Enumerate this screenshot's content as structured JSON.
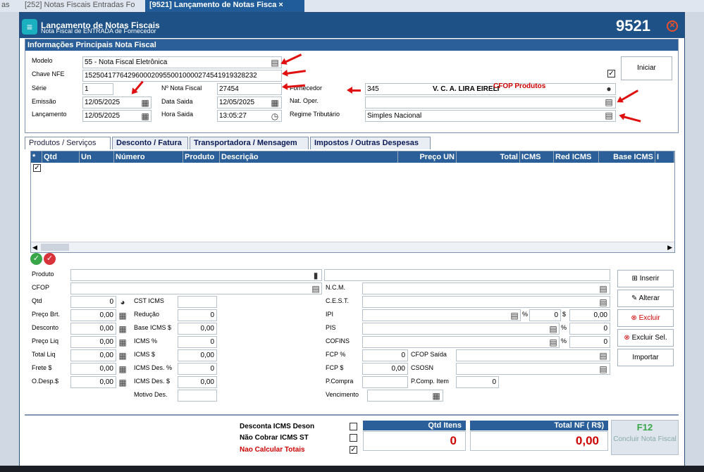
{
  "tabs": {
    "t1": "as",
    "t2": "[252] Notas Fiscais Entradas Fo",
    "t3": "[9521] Lançamento de Notas Fisca",
    "close": "×"
  },
  "window": {
    "title": "Lançamento de Notas Fiscais",
    "subtitle": "Nota Fiscal de ENTRADA de Fornecedor",
    "code": "9521"
  },
  "info": {
    "header": "Informações Principais Nota Fiscal",
    "modelo_lbl": "Modelo",
    "modelo": "55 - Nota Fiscal Eletrônica",
    "chave_lbl": "Chave NFE",
    "chave": "15250417764296000209550010000274541919328232",
    "serie_lbl": "Série",
    "serie": "1",
    "nnota_lbl": "Nº Nota Fiscal",
    "nnota": "27454",
    "emissao_lbl": "Emissão",
    "emissao": "12/05/2025",
    "datasaida_lbl": "Data Saida",
    "datasaida": "12/05/2025",
    "lanc_lbl": "Lançamento",
    "lanc": "12/05/2025",
    "horasaida_lbl": "Hora Saida",
    "horasaida": "13:05:27",
    "fornecedor_lbl": "Fornecedor",
    "fornecedor_cod": "345",
    "fornecedor_nome": "V. C. A. LIRA EIRELI",
    "natoper_lbl": "Nat. Oper.",
    "natoper": "",
    "regime_lbl": "Regime Tributário",
    "regime": "Simples Nacional",
    "cfop_lbl": "CFOP Produtos",
    "iniciar": "Iniciar"
  },
  "subtabs": [
    "Produtos / Serviços",
    "Desconto / Fatura",
    "Transportadora / Mensagem",
    "Impostos / Outras Despesas"
  ],
  "grid": {
    "cols": [
      "*",
      "Qtd",
      "Un",
      "Número",
      "Produto",
      "Descrição",
      "Preço UN",
      "Total",
      "ICMS",
      "Red ICMS",
      "Base ICMS",
      "I"
    ]
  },
  "item": {
    "produto_lbl": "Produto",
    "produto": "",
    "cfop_lbl": "CFOP",
    "cfop": "",
    "qtd_lbl": "Qtd",
    "qtd": "0",
    "precobrt_lbl": "Preço Brt.",
    "precobrt": "0,00",
    "desconto_lbl": "Desconto",
    "desconto": "0,00",
    "precoliq_lbl": "Preço Liq",
    "precoliq": "0,00",
    "totalliq_lbl": "Total Liq",
    "totalliq": "0,00",
    "frete_lbl": "Frete $",
    "frete": "0,00",
    "odesp_lbl": "O.Desp.$",
    "odesp": "0,00",
    "csticms_lbl": "CST ICMS",
    "csticms": "",
    "reducao_lbl": "Redução",
    "reducao": "0",
    "baseicms_lbl": "Base ICMS $",
    "baseicms": "0,00",
    "icmsp_lbl": "ICMS %",
    "icmsp": "0",
    "icmsv_lbl": "ICMS $",
    "icmsv": "0,00",
    "icmsdesp_lbl": "ICMS Des. %",
    "icmsdesp": "0",
    "icmsdesv_lbl": "ICMS Des. $",
    "icmsdesv": "0,00",
    "motivo_lbl": "Motivo Des.",
    "motivo": "",
    "ncm_lbl": "N.C.M.",
    "cest_lbl": "C.E.S.T.",
    "ipi_lbl": "IPI",
    "ipi_pct": "0",
    "ipi_val": "0,00",
    "pis_lbl": "PIS",
    "pis_pct": "0",
    "cofins_lbl": "COFINS",
    "cofins_pct": "0",
    "fcpp_lbl": "FCP %",
    "fcpp": "0",
    "fcpv_lbl": "FCP $",
    "fcpv": "0,00",
    "pcompra_lbl": "P.Compra",
    "pcompra": "",
    "cfopsaida_lbl": "CFOP Saída",
    "csosn_lbl": "CSOSN",
    "pcompitem_lbl": "P.Comp. Item",
    "pcompitem": "0",
    "venc_lbl": "Vencimento",
    "venc": "",
    "pct": "%",
    "cur": "$"
  },
  "actions": {
    "inserir": "Inserir",
    "alterar": "Alterar",
    "excluir": "Excluir",
    "excluirsel": "Excluir Sel.",
    "importar": "Importar"
  },
  "footer": {
    "desconta": "Desconta ICMS Deson",
    "naocobrar": "Não Cobrar ICMS ST",
    "naocalc": "Nao Calcular Totais",
    "qtditens_lbl": "Qtd Itens",
    "qtditens": "0",
    "totalnf_lbl": "Total NF ( R$)",
    "totalnf": "0,00",
    "f12": "F12",
    "concluir": "Concluir Nota Fiscal"
  }
}
